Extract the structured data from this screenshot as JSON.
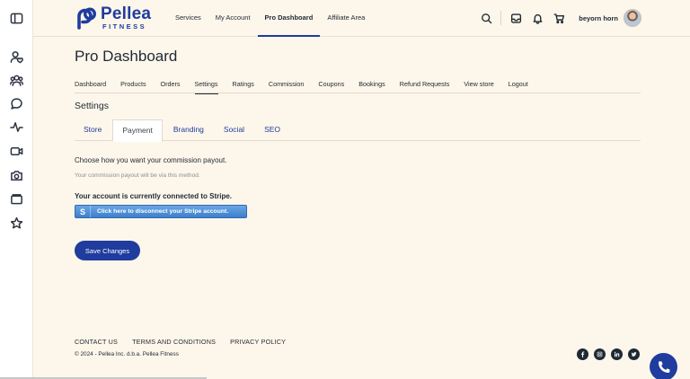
{
  "brand": {
    "name": "Pellea",
    "sub": "FITNESS",
    "color": "#1f3c9e"
  },
  "rail": {
    "icons": [
      "sidebar-toggle-icon",
      "user-heart-icon",
      "users-icon",
      "chat-icon",
      "activity-icon",
      "video-icon",
      "camera-icon",
      "folder-icon",
      "star-icon"
    ]
  },
  "topnav": {
    "links": [
      "Services",
      "My Account",
      "Pro Dashboard",
      "Affiliate Area"
    ],
    "active": "Pro Dashboard",
    "user_name": "beyorn horn"
  },
  "page": {
    "title": "Pro Dashboard"
  },
  "subnav": {
    "items": [
      "Dashboard",
      "Products",
      "Orders",
      "Settings",
      "Ratings",
      "Commission",
      "Coupons",
      "Bookings",
      "Refund Requests",
      "View store",
      "Logout"
    ],
    "active": "Settings"
  },
  "settings": {
    "title": "Settings",
    "tabs": [
      "Store",
      "Payment",
      "Branding",
      "Social",
      "SEO"
    ],
    "active_tab": "Payment"
  },
  "payment": {
    "choose_label": "Choose how you want your commission payout.",
    "hint": "Your commission payout will be via this method.",
    "connected_label": "Your account is currently connected to Stripe.",
    "stripe_icon": "S",
    "stripe_button": "Click here to disconnect your Stripe account.",
    "save_button": "Save Changes"
  },
  "footer": {
    "links": [
      "CONTACT US",
      "TERMS AND CONDITIONS",
      "PRIVACY POLICY"
    ],
    "copyright": "© 2024 - Pellea Inc. d.b.a. Pellea Fitness",
    "socials": [
      "facebook-icon",
      "instagram-icon",
      "linkedin-icon",
      "twitter-icon"
    ]
  },
  "colors": {
    "background": "#fdf6ea",
    "accent": "#1f3c9e",
    "stripe": "#3c7fcb"
  }
}
